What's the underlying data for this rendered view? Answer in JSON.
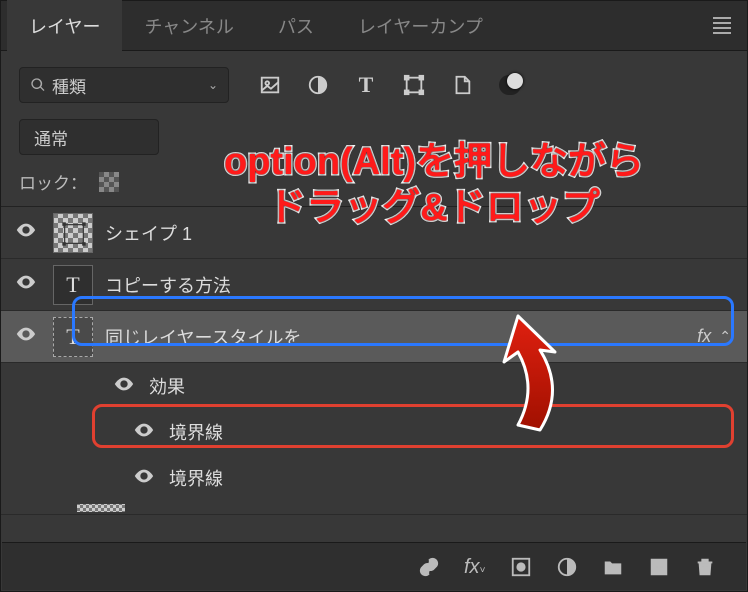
{
  "tabs": {
    "layers": "レイヤー",
    "channels": "チャンネル",
    "paths": "パス",
    "comps": "レイヤーカンプ"
  },
  "filter": {
    "label": "種類"
  },
  "blend": {
    "mode": "通常"
  },
  "lock": {
    "label": "ロック："
  },
  "layers": [
    {
      "name": "シェイプ 1"
    },
    {
      "name": "コピーする方法"
    },
    {
      "name": "同じレイヤースタイルを",
      "fx": "fx"
    },
    {
      "effect_label": "効果"
    },
    {
      "stroke1": "境界線"
    },
    {
      "stroke2": "境界線"
    }
  ],
  "annotation": {
    "line1": "option(Alt)を押しながら",
    "line2": "ドラッグ&ドロップ"
  }
}
